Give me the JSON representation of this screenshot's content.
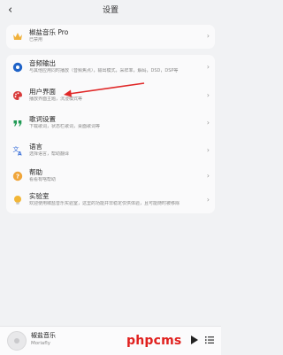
{
  "header": {
    "back_icon": "chevron-left-icon",
    "title": "设置"
  },
  "pro": {
    "label": "椒盐音乐 Pro",
    "sub": "已禁用"
  },
  "items": [
    {
      "key": "audio",
      "icon": "audio-output-icon",
      "label": "音频输出",
      "sub": "与其他应用同时播放（音频焦点），输出模式，采样率，解码，DSD，DSP等"
    },
    {
      "key": "ui",
      "icon": "palette-icon",
      "label": "用户界面",
      "sub": "播放界面主题，沉浸模式等"
    },
    {
      "key": "lyrics",
      "icon": "quote-icon",
      "label": "歌词设置",
      "sub": "下载歌词，状态栏歌词，桌面歌词等"
    },
    {
      "key": "language",
      "icon": "translate-icon",
      "label": "语言",
      "sub": "选择语言，帮助翻译"
    },
    {
      "key": "help",
      "icon": "help-icon",
      "label": "帮助",
      "sub": "看看有啥帮助"
    },
    {
      "key": "lab",
      "icon": "lightbulb-icon",
      "label": "实验室",
      "sub": "欢迎使用椒盐音乐实验室，这里的功能并非稳定仅供体验，且可能随时被移除"
    }
  ],
  "now_playing": {
    "title": "椒盐音乐",
    "subtitle": "Moriafly"
  },
  "watermark": "phpcms",
  "colors": {
    "accent": "#f0a53a",
    "arrow": "#e02828",
    "watermark": "#e0201e"
  }
}
